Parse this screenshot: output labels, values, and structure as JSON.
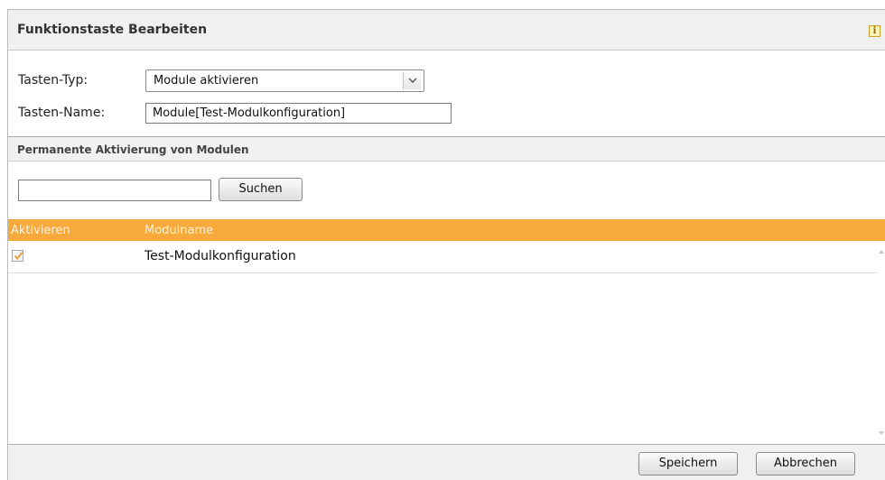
{
  "dialog": {
    "title": "Funktionstaste Bearbeiten",
    "info_icon_glyph": "i"
  },
  "form": {
    "type_label": "Tasten-Typ:",
    "type_value": "Module aktivieren",
    "name_label": "Tasten-Name:",
    "name_value": "Module[Test-Modulkonfiguration]"
  },
  "section": {
    "title": "Permanente Aktivierung von Modulen"
  },
  "search": {
    "value": "",
    "button_label": "Suchen"
  },
  "table": {
    "columns": [
      "Aktivieren",
      "Modulname"
    ],
    "rows": [
      {
        "checked": true,
        "name": "Test-Modulkonfiguration"
      }
    ]
  },
  "footer": {
    "save_label": "Speichern",
    "cancel_label": "Abbrechen"
  },
  "colors": {
    "accent": "#f8a93b",
    "checkmark": "#e8a043"
  }
}
